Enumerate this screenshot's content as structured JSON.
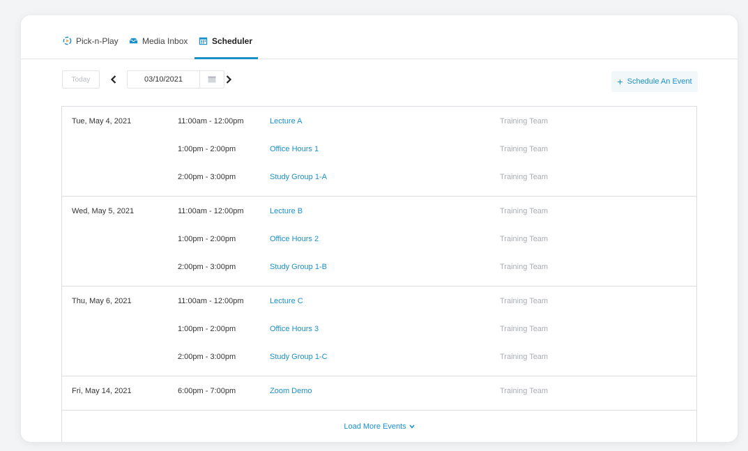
{
  "tabs": [
    {
      "label": "Pick-n-Play",
      "icon": "pick-n-play-icon"
    },
    {
      "label": "Media Inbox",
      "icon": "inbox-icon"
    },
    {
      "label": "Scheduler",
      "icon": "calendar-icon",
      "active": true
    }
  ],
  "toolbar": {
    "today_label": "Today",
    "date_value": "03/10/2021",
    "schedule_label": "Schedule An Event",
    "schedule_plus": "+"
  },
  "events": [
    {
      "date": "Tue, May 4, 2021",
      "items": [
        {
          "time": "11:00am - 12:00pm",
          "name": "Lecture A",
          "team": "Training Team"
        },
        {
          "time": "1:00pm - 2:00pm",
          "name": "Office Hours 1",
          "team": "Training Team"
        },
        {
          "time": "2:00pm - 3:00pm",
          "name": "Study Group 1-A",
          "team": "Training Team"
        }
      ]
    },
    {
      "date": "Wed, May 5, 2021",
      "items": [
        {
          "time": "11:00am - 12:00pm",
          "name": "Lecture B",
          "team": "Training Team"
        },
        {
          "time": "1:00pm - 2:00pm",
          "name": "Office Hours 2",
          "team": "Training Team"
        },
        {
          "time": "2:00pm - 3:00pm",
          "name": "Study Group 1-B",
          "team": "Training Team"
        }
      ]
    },
    {
      "date": "Thu, May 6, 2021",
      "items": [
        {
          "time": "11:00am - 12:00pm",
          "name": "Lecture C",
          "team": "Training Team"
        },
        {
          "time": "1:00pm - 2:00pm",
          "name": "Office Hours 3",
          "team": "Training Team"
        },
        {
          "time": "2:00pm - 3:00pm",
          "name": "Study Group 1-C",
          "team": "Training Team"
        }
      ]
    },
    {
      "date": "Fri, May 14, 2021",
      "items": [
        {
          "time": "6:00pm - 7:00pm",
          "name": "Zoom Demo",
          "team": "Training Team"
        }
      ]
    }
  ],
  "load_more_label": "Load More Events",
  "colors": {
    "accent": "#1a8fc9",
    "muted": "#a9adb3"
  }
}
